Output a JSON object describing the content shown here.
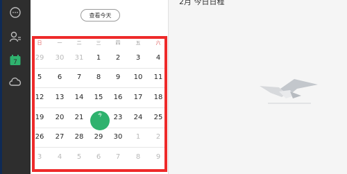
{
  "sidebar": {
    "items": [
      {
        "name": "chat-icon"
      },
      {
        "name": "contacts-icon"
      },
      {
        "name": "calendar-icon",
        "day": "7"
      },
      {
        "name": "cloud-icon"
      }
    ],
    "accent": "#2fb26e"
  },
  "calendar": {
    "today_button": "查看今天",
    "weekdays": [
      "日",
      "一",
      "二",
      "三",
      "四",
      "五",
      "六"
    ],
    "weeks": [
      [
        "29",
        "30",
        "31",
        "1",
        "2",
        "3",
        "4"
      ],
      [
        "5",
        "6",
        "7",
        "8",
        "9",
        "10",
        "11"
      ],
      [
        "12",
        "13",
        "14",
        "15",
        "16",
        "17",
        "18"
      ],
      [
        "19",
        "20",
        "21",
        "今",
        "23",
        "24",
        "25"
      ],
      [
        "26",
        "27",
        "28",
        "29",
        "30",
        "1",
        "2"
      ],
      [
        "3",
        "4",
        "5",
        "6",
        "7",
        "8",
        "9"
      ]
    ],
    "today_marker": "今",
    "today_color": "#2fb26e",
    "frame_color": "#ee2a2a"
  },
  "detail": {
    "title": "2月 今日日程"
  }
}
